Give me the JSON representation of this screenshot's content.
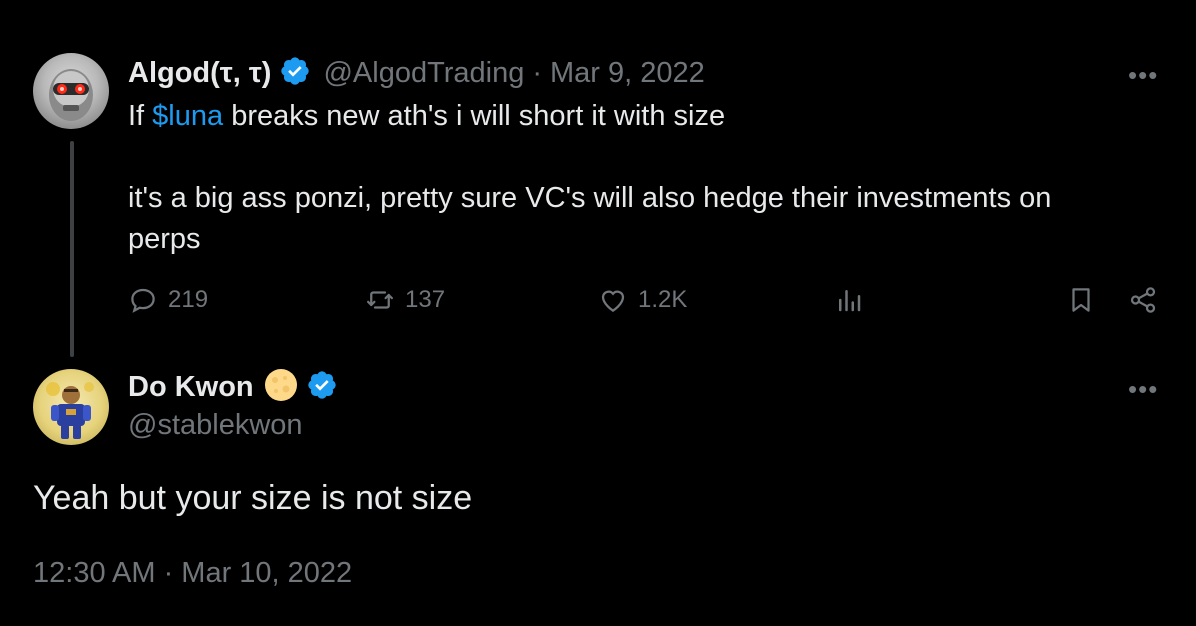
{
  "colors": {
    "background": "#000000",
    "text": "#e7e9ea",
    "muted": "#71767b",
    "link": "#1d9bf0",
    "verified": "#1d9bf0"
  },
  "quoted_tweet": {
    "author_name": "Algod(τ, τ)",
    "handle": "@AlgodTrading",
    "separator": "·",
    "date": "Mar 9, 2022",
    "text_prefix": "If ",
    "cashtag": "$luna",
    "text_suffix": " breaks new ath's i will short it with size",
    "text_para2": "it's a big ass ponzi, pretty sure VC's will also hedge their investments on perps",
    "actions": {
      "replies": "219",
      "reposts": "137",
      "likes": "1.2K"
    },
    "icons": [
      "reply-icon",
      "repost-icon",
      "like-icon",
      "views-icon",
      "bookmark-icon",
      "share-icon",
      "more-icon",
      "verified-badge-icon"
    ]
  },
  "main_tweet": {
    "author_name": "Do Kwon",
    "handle": "@stablekwon",
    "text": "Yeah but your size is not size",
    "timestamp": "12:30 AM · Mar 10, 2022"
  }
}
